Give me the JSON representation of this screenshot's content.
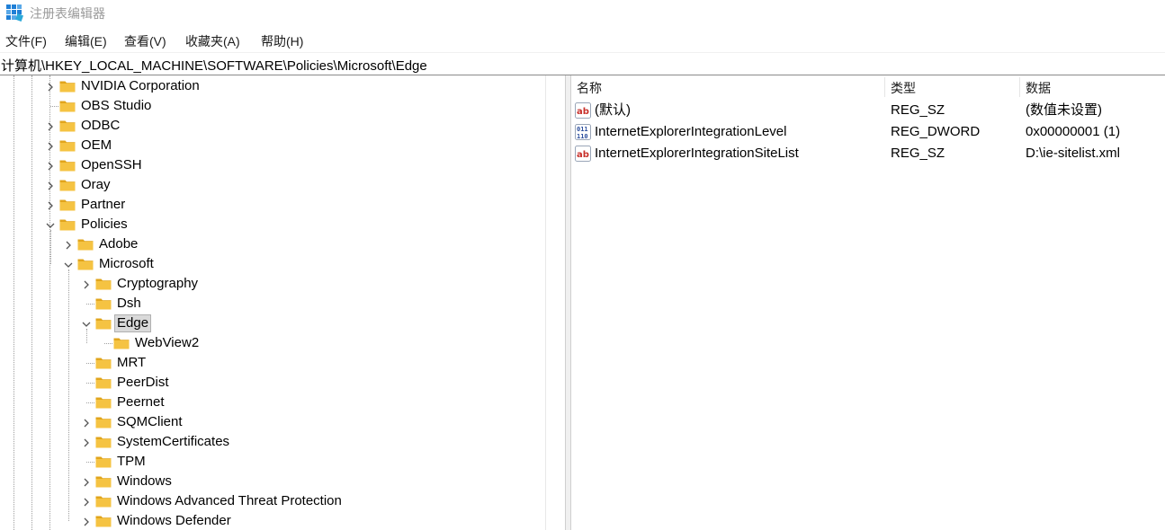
{
  "window": {
    "title": "注册表编辑器"
  },
  "menu": [
    "文件(F)",
    "编辑(E)",
    "查看(V)",
    "收藏夹(A)",
    "帮助(H)"
  ],
  "address": "计算机\\HKEY_LOCAL_MACHINE\\SOFTWARE\\Policies\\Microsoft\\Edge",
  "tree": [
    {
      "label": "NVIDIA Corporation",
      "depth": 0,
      "expander": "collapsed"
    },
    {
      "label": "OBS Studio",
      "depth": 0,
      "expander": "none"
    },
    {
      "label": "ODBC",
      "depth": 0,
      "expander": "collapsed"
    },
    {
      "label": "OEM",
      "depth": 0,
      "expander": "collapsed"
    },
    {
      "label": "OpenSSH",
      "depth": 0,
      "expander": "collapsed"
    },
    {
      "label": "Oray",
      "depth": 0,
      "expander": "collapsed"
    },
    {
      "label": "Partner",
      "depth": 0,
      "expander": "collapsed"
    },
    {
      "label": "Policies",
      "depth": 0,
      "expander": "expanded"
    },
    {
      "label": "Adobe",
      "depth": 1,
      "expander": "collapsed"
    },
    {
      "label": "Microsoft",
      "depth": 1,
      "expander": "expanded"
    },
    {
      "label": "Cryptography",
      "depth": 2,
      "expander": "collapsed"
    },
    {
      "label": "Dsh",
      "depth": 2,
      "expander": "none"
    },
    {
      "label": "Edge",
      "depth": 2,
      "expander": "expanded",
      "selected": true
    },
    {
      "label": "WebView2",
      "depth": 3,
      "expander": "none"
    },
    {
      "label": "MRT",
      "depth": 2,
      "expander": "none"
    },
    {
      "label": "PeerDist",
      "depth": 2,
      "expander": "none"
    },
    {
      "label": "Peernet",
      "depth": 2,
      "expander": "none"
    },
    {
      "label": "SQMClient",
      "depth": 2,
      "expander": "collapsed"
    },
    {
      "label": "SystemCertificates",
      "depth": 2,
      "expander": "collapsed"
    },
    {
      "label": "TPM",
      "depth": 2,
      "expander": "none"
    },
    {
      "label": "Windows",
      "depth": 2,
      "expander": "collapsed"
    },
    {
      "label": "Windows Advanced Threat Protection",
      "depth": 2,
      "expander": "collapsed"
    },
    {
      "label": "Windows Defender",
      "depth": 2,
      "expander": "collapsed"
    }
  ],
  "list": {
    "headers": {
      "name": "名称",
      "type": "类型",
      "data": "数据"
    },
    "rows": [
      {
        "icon": "string-value-icon",
        "name": "(默认)",
        "type": "REG_SZ",
        "data": "(数值未设置)"
      },
      {
        "icon": "binary-value-icon",
        "name": "InternetExplorerIntegrationLevel",
        "type": "REG_DWORD",
        "data": "0x00000001 (1)"
      },
      {
        "icon": "string-value-icon",
        "name": "InternetExplorerIntegrationSiteList",
        "type": "REG_SZ",
        "data": "D:\\ie-sitelist.xml"
      }
    ]
  },
  "colors": {
    "folder": "#f5c342",
    "folder_dark": "#e1a51c",
    "selection": "#d9d9d9",
    "app_icon": "#1f7fd6"
  }
}
